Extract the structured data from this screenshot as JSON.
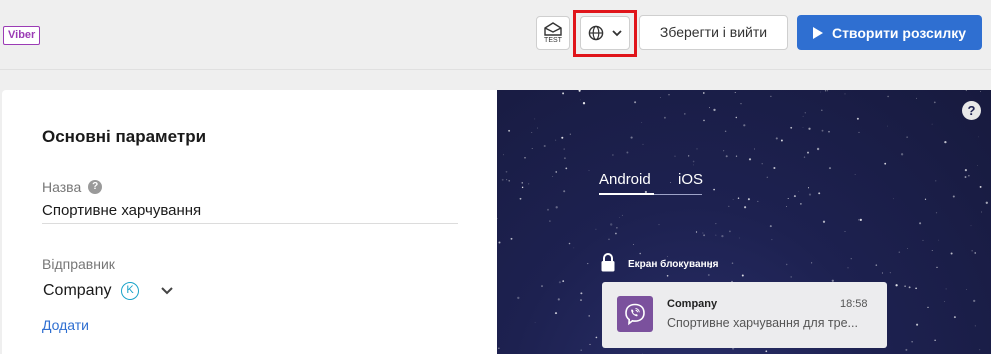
{
  "topbar": {
    "channel_badge": "Viber",
    "test_label": "TEST",
    "save_label": "Зберегти і вийти",
    "create_label": "Створити розсилку"
  },
  "settings": {
    "title": "Основні параметри",
    "name_label": "Назва",
    "name_value": "Спортивне харчування",
    "sender_label": "Відправник",
    "sender_value": "Company",
    "sender_badge": "K",
    "add_link": "Додати",
    "help_glyph": "?"
  },
  "preview": {
    "help_glyph": "?",
    "tabs": [
      "Android",
      "iOS"
    ],
    "active_tab": "Android",
    "lock_screen_label": "Екран блокування",
    "notification": {
      "sender": "Company",
      "time": "18:58",
      "text": "Спортивне харчування для тре..."
    }
  },
  "colors": {
    "primary": "#2f6fd1",
    "viber": "#7b519d",
    "highlight": "#e0151b"
  },
  "icons": [
    "envelope-test-icon",
    "globe-icon",
    "chevron-down-icon",
    "play-icon",
    "help-icon",
    "lock-icon",
    "viber-phone-icon"
  ]
}
